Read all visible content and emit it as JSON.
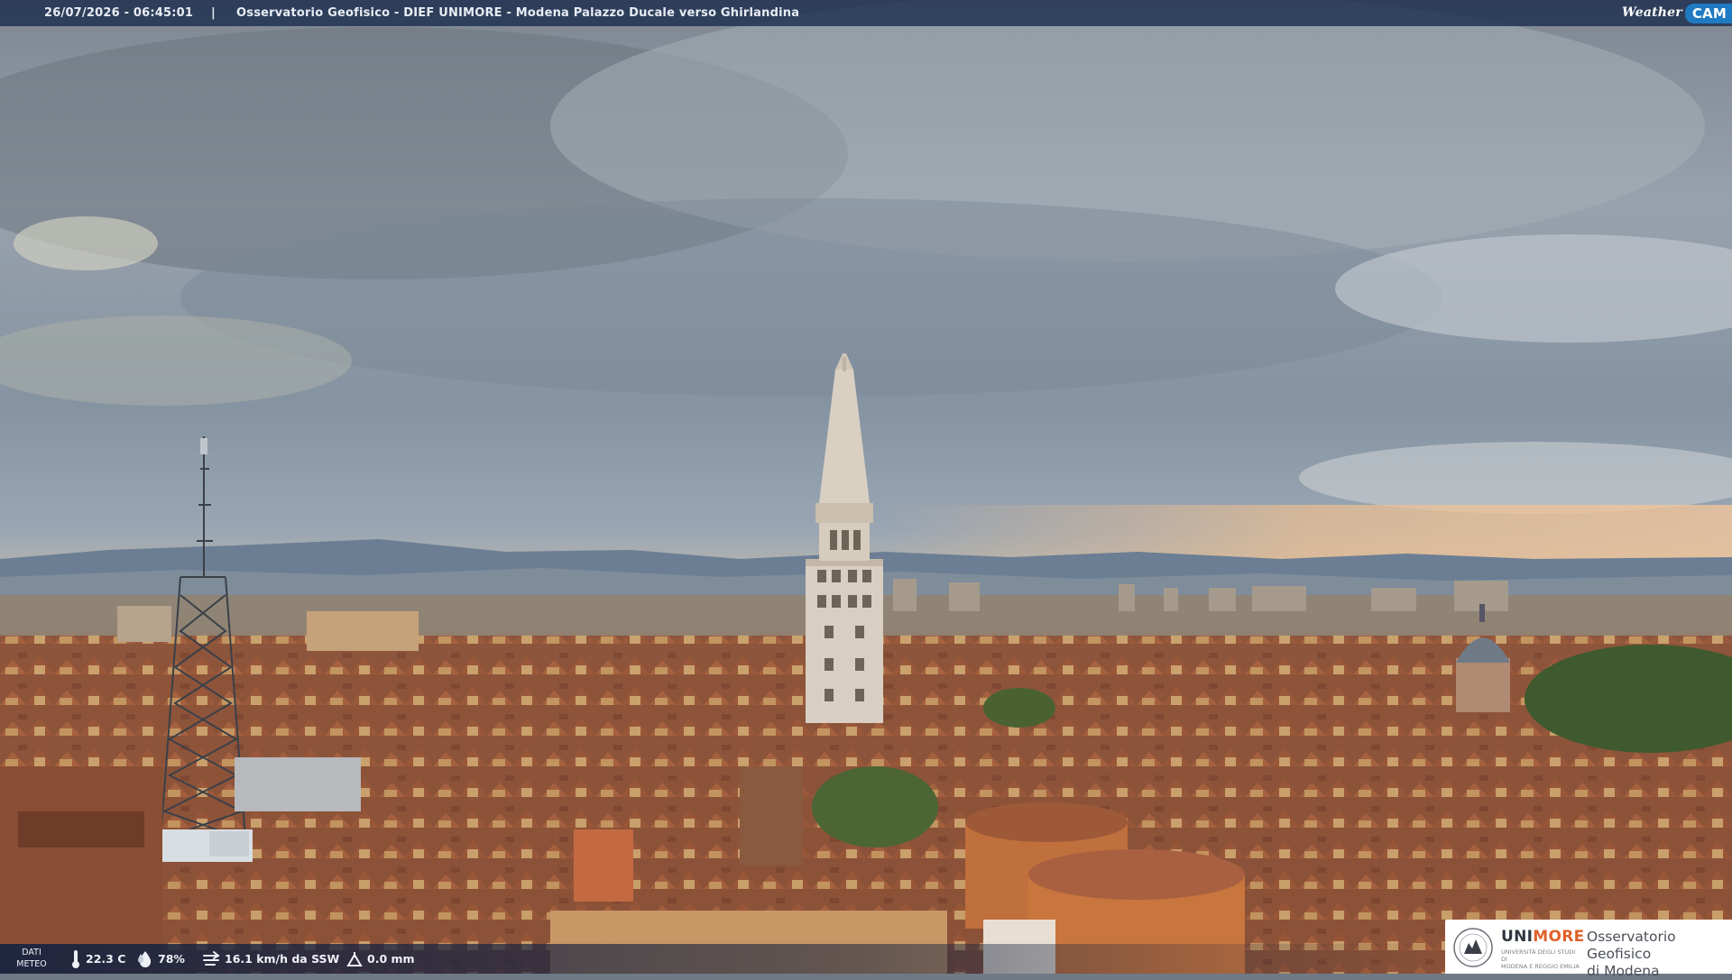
{
  "overlay": {
    "timestamp": "26/07/2026 - 06:45:01",
    "separator": "|",
    "title": "Osservatorio Geofisico - DIEF UNIMORE - Modena Palazzo Ducale verso Ghirlandina",
    "brand_weather": "Weather",
    "brand_cam": "CAM"
  },
  "weather_data": {
    "label_line1": "DATI",
    "label_line2": "METEO",
    "temperature": "22.3 C",
    "humidity": "78%",
    "wind": "16.1 km/h da SSW",
    "rain": "0.0 mm"
  },
  "logo": {
    "uni_part1": "UNI",
    "uni_part2": "MORE",
    "university_line1": "UNIVERSITÀ DEGLI STUDI DI",
    "university_line2": "MODENA E REGGIO EMILIA",
    "observatory_line1": "Osservatorio Geofisico",
    "observatory_line2": "di Modena"
  },
  "colors": {
    "bar": "#1c2e4e",
    "accent": "#e0612a",
    "brand_blue": "#1f7ac2"
  }
}
